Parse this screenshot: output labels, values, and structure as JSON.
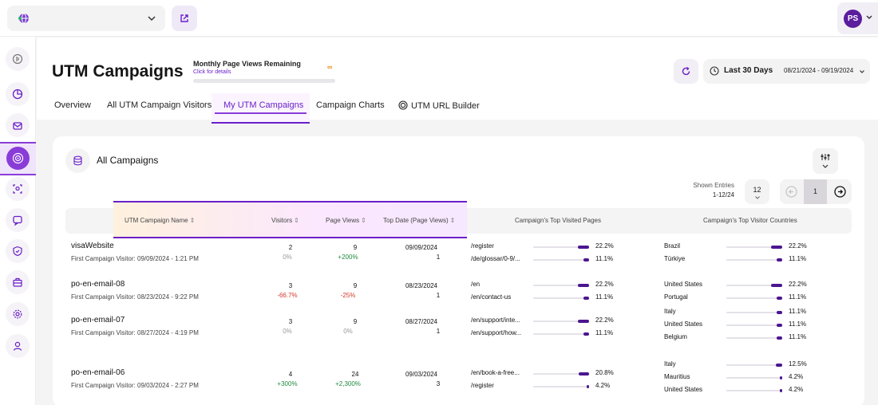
{
  "header": {
    "title": "UTM Campaigns",
    "quota_title": "Monthly Page Views Remaining",
    "quota_link": "Click for details",
    "quota_value": "∞",
    "date_label": "Last 30 Days",
    "date_range": "08/21/2024 - 09/19/2024"
  },
  "user": {
    "initials": "PS"
  },
  "tabs": [
    {
      "label": "Overview"
    },
    {
      "label": "All UTM Campaign Visitors"
    },
    {
      "label": "My UTM Campaigns",
      "active": true
    },
    {
      "label": "Campaign Charts"
    },
    {
      "label": "UTM URL Builder"
    }
  ],
  "card": {
    "title": "All Campaigns",
    "shown_label": "Shown Entries",
    "shown_value": "1-12/24",
    "entries": "12",
    "page": "1"
  },
  "columns": {
    "name": "UTM Campaign Name",
    "visitors": "Visitors",
    "page_views": "Page Views",
    "top_date": "Top Date (Page Views)",
    "top_pages": "Campaign's Top Visited Pages",
    "top_countries": "Campaign's Top Visitor Countries"
  },
  "rows": [
    {
      "name": "visaWebsite",
      "first_visit": "First Campaign Visitor: 09/09/2024 - 1:21 PM",
      "visitors": "2",
      "visitors_change": "0%",
      "page_views": "9",
      "page_views_change": "+200%",
      "top_date": "09/09/2024",
      "top_date_views": "1",
      "pages": [
        {
          "label": "/register",
          "pct": "22.2%",
          "value": 22.2
        },
        {
          "label": "/de/glossar/0-9/...",
          "pct": "11.1%",
          "value": 11.1
        }
      ],
      "countries": [
        {
          "label": "Brazil",
          "pct": "22.2%",
          "value": 22.2
        },
        {
          "label": "Türkiye",
          "pct": "11.1%",
          "value": 11.1
        }
      ]
    },
    {
      "name": "po-en-email-08",
      "first_visit": "First Campaign Visitor: 08/23/2024 - 9:22 PM",
      "visitors": "3",
      "visitors_change": "-66.7%",
      "page_views": "9",
      "page_views_change": "-25%",
      "top_date": "08/23/2024",
      "top_date_views": "1",
      "pages": [
        {
          "label": "/en",
          "pct": "22.2%",
          "value": 22.2
        },
        {
          "label": "/en/contact-us",
          "pct": "11.1%",
          "value": 11.1
        }
      ],
      "countries": [
        {
          "label": "United States",
          "pct": "22.2%",
          "value": 22.2
        },
        {
          "label": "Portugal",
          "pct": "11.1%",
          "value": 11.1
        }
      ]
    },
    {
      "name": "po-en-email-07",
      "first_visit": "First Campaign Visitor: 08/27/2024 - 4:19 PM",
      "visitors": "3",
      "visitors_change": "0%",
      "page_views": "9",
      "page_views_change": "0%",
      "top_date": "08/27/2024",
      "top_date_views": "1",
      "pages": [
        {
          "label": "/en/support/inte...",
          "pct": "22.2%",
          "value": 22.2
        },
        {
          "label": "/en/support/how...",
          "pct": "11.1%",
          "value": 11.1
        }
      ],
      "countries": [
        {
          "label": "Italy",
          "pct": "11.1%",
          "value": 11.1
        },
        {
          "label": "United States",
          "pct": "11.1%",
          "value": 11.1
        },
        {
          "label": "Belgium",
          "pct": "11.1%",
          "value": 11.1
        }
      ]
    },
    {
      "name": "po-en-email-06",
      "first_visit": "First Campaign Visitor: 09/03/2024 - 2:27 PM",
      "visitors": "4",
      "visitors_change": "+300%",
      "page_views": "24",
      "page_views_change": "+2,300%",
      "top_date": "09/03/2024",
      "top_date_views": "3",
      "pages": [
        {
          "label": "/en/book-a-free...",
          "pct": "20.8%",
          "value": 20.8
        },
        {
          "label": "/register",
          "pct": "4.2%",
          "value": 4.2
        }
      ],
      "countries": [
        {
          "label": "Italy",
          "pct": "12.5%",
          "value": 12.5
        },
        {
          "label": "Mauritius",
          "pct": "4.2%",
          "value": 4.2
        },
        {
          "label": "United States",
          "pct": "4.2%",
          "value": 4.2
        }
      ]
    }
  ],
  "colors": {
    "accent": "#6a1fc8",
    "bar": "#4b168f",
    "positive": "#1f8a3e",
    "negative": "#d23a2a",
    "infinity": "#f08a1c"
  }
}
